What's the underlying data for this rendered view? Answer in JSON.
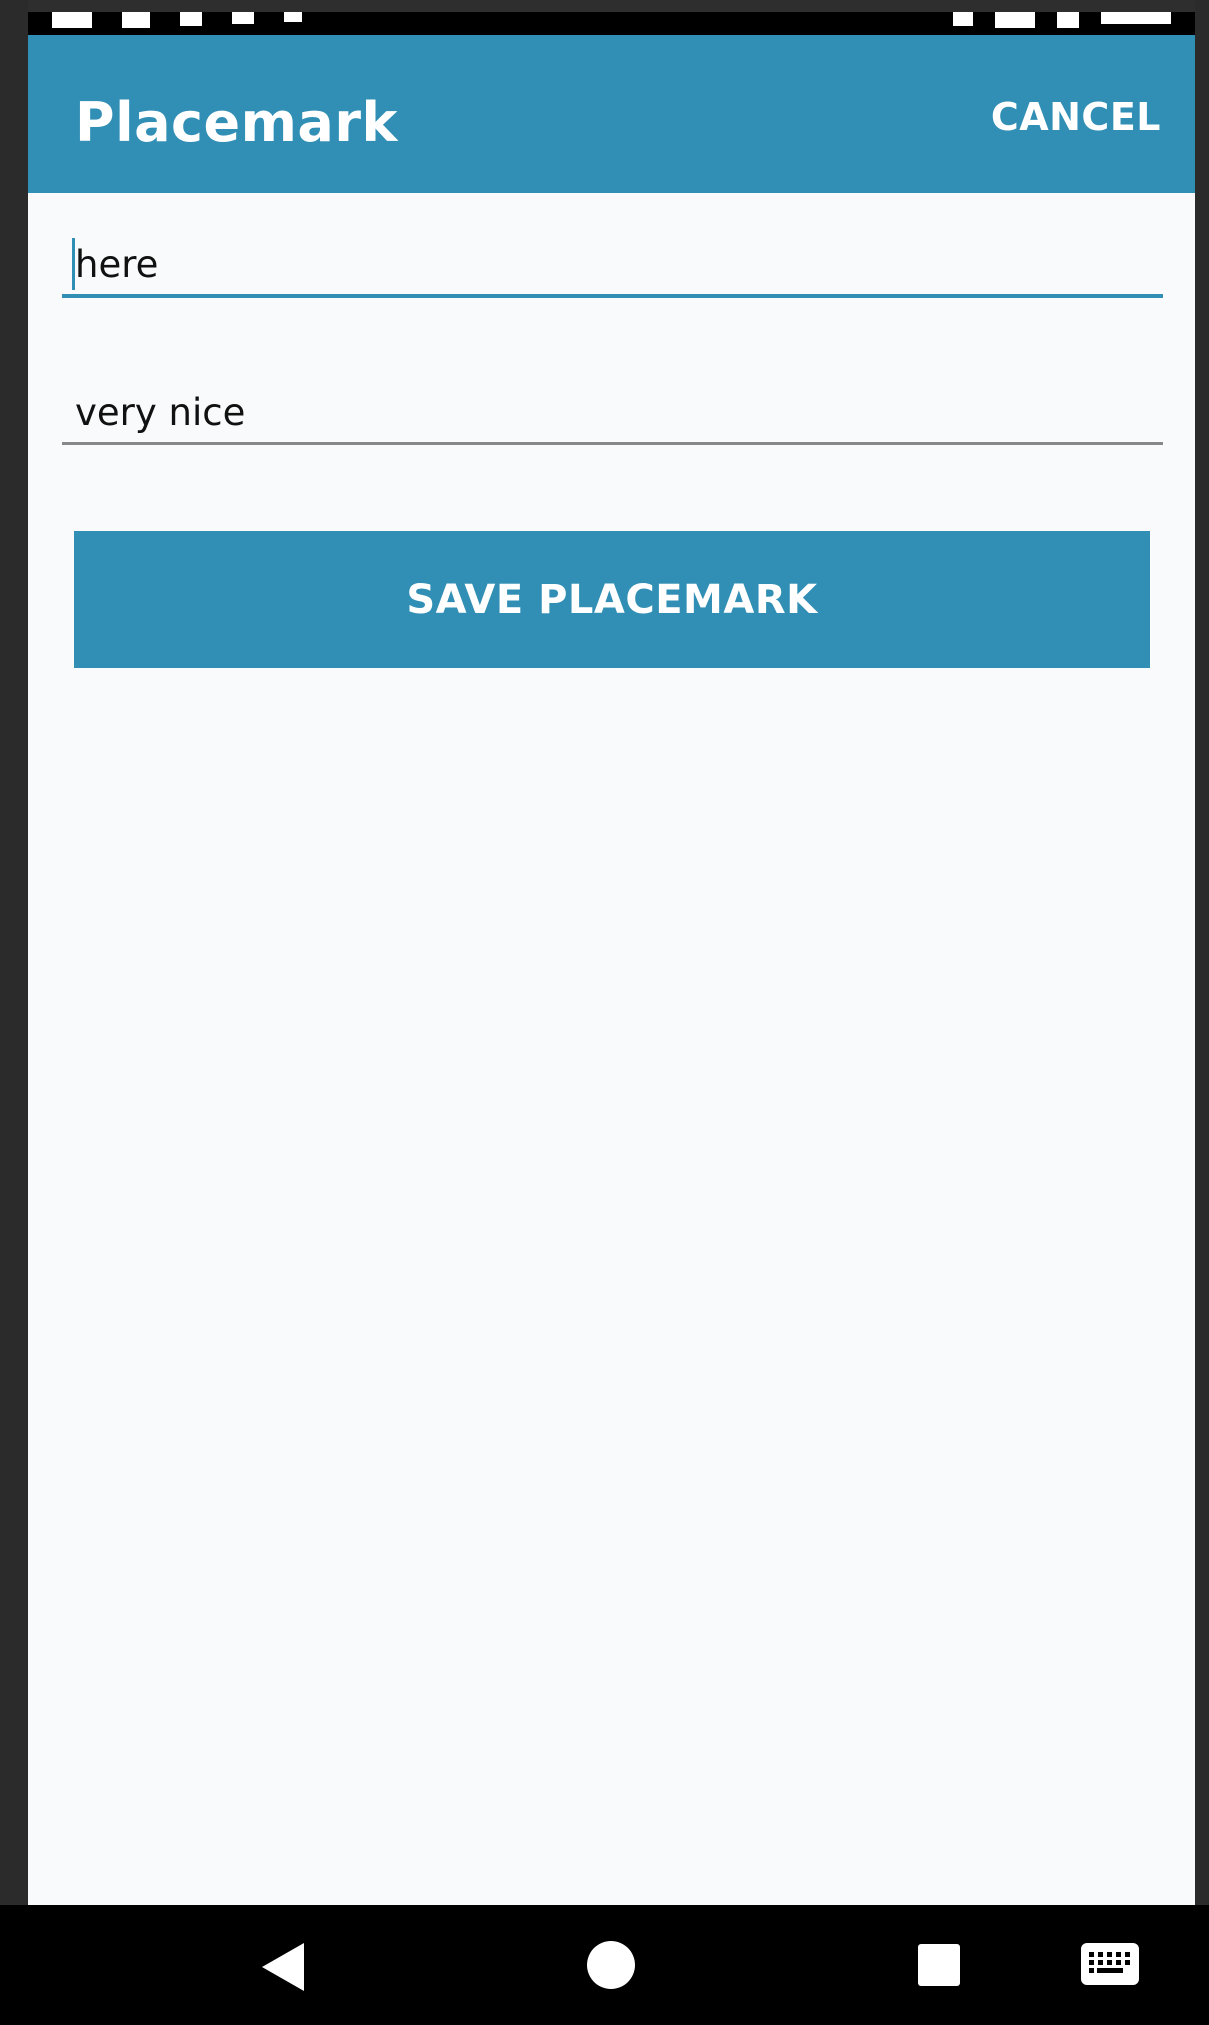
{
  "toolbar": {
    "title": "Placemark",
    "cancel_label": "CANCEL"
  },
  "form": {
    "title_value": "here",
    "description_value": "very nice",
    "save_label": "SAVE PLACEMARK"
  },
  "colors": {
    "primary": "#318fb5",
    "background": "#f9fafb",
    "nav_bar": "#000000"
  },
  "nav_bar": {
    "icons": [
      "back-icon",
      "home-icon",
      "recents-icon",
      "keyboard-icon"
    ]
  }
}
